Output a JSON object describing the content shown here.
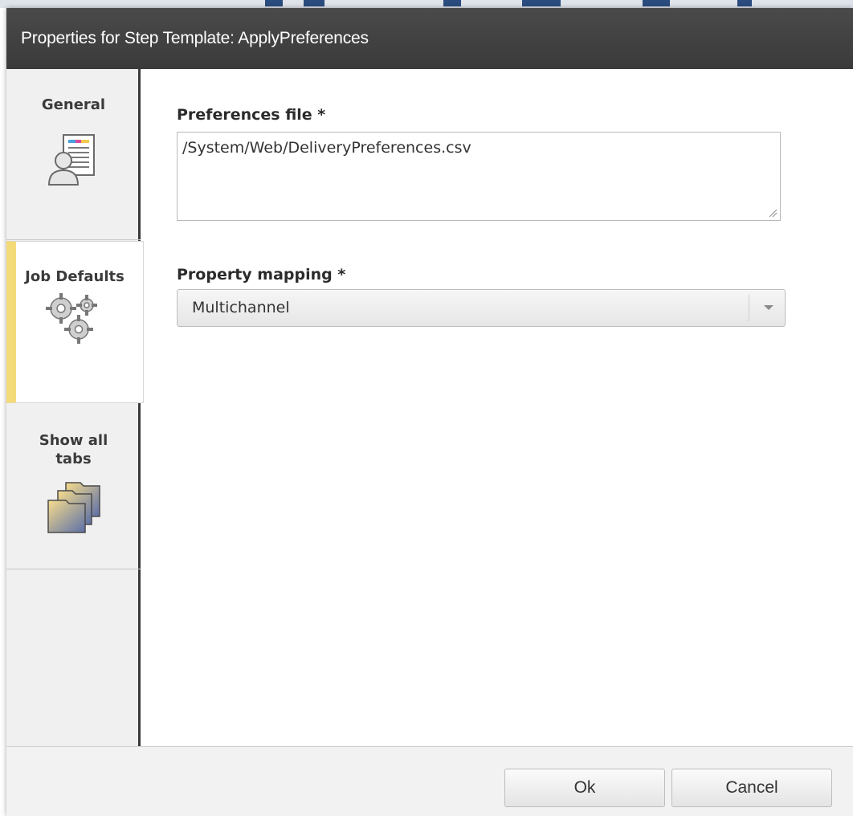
{
  "dialog": {
    "title": "Properties for Step Template: ApplyPreferences"
  },
  "sidebar": {
    "tabs": [
      {
        "label": "General",
        "icon": "user-document-icon"
      },
      {
        "label": "Job Defaults",
        "icon": "gears-icon",
        "active": true
      },
      {
        "label": "Show all tabs",
        "icon": "folders-icon"
      }
    ]
  },
  "form": {
    "preferences_file": {
      "label": "Preferences file *",
      "value": "/System/Web/DeliveryPreferences.csv"
    },
    "property_mapping": {
      "label": "Property mapping *",
      "value": "Multichannel"
    }
  },
  "footer": {
    "ok_label": "Ok",
    "cancel_label": "Cancel"
  },
  "colors": {
    "titlebar": "#3f3f3f",
    "active_tab_accent": "#f4db7a",
    "sidebar_bg": "#f0f0f0"
  }
}
